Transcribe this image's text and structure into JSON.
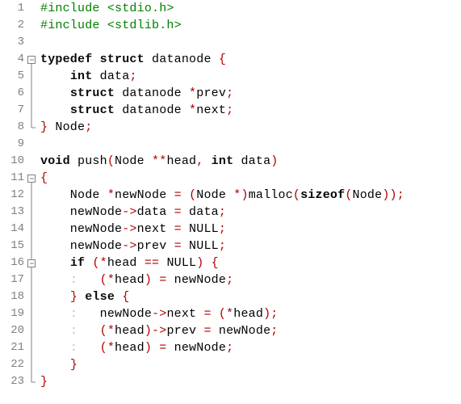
{
  "lines": [
    {
      "n": 1,
      "fold": "none",
      "tokens": [
        [
          "pp",
          "#include <stdio.h>"
        ]
      ]
    },
    {
      "n": 2,
      "fold": "none",
      "tokens": [
        [
          "pp",
          "#include <stdlib.h>"
        ]
      ]
    },
    {
      "n": 3,
      "fold": "none",
      "tokens": []
    },
    {
      "n": 4,
      "fold": "open-top",
      "tokens": [
        [
          "kw",
          "typedef"
        ],
        [
          "id",
          " "
        ],
        [
          "kw",
          "struct"
        ],
        [
          "id",
          " datanode "
        ],
        [
          "op",
          "{"
        ]
      ]
    },
    {
      "n": 5,
      "fold": "mid",
      "tokens": [
        [
          "id",
          "    "
        ],
        [
          "kw",
          "int"
        ],
        [
          "id",
          " data"
        ],
        [
          "op",
          ";"
        ]
      ]
    },
    {
      "n": 6,
      "fold": "mid",
      "tokens": [
        [
          "id",
          "    "
        ],
        [
          "kw",
          "struct"
        ],
        [
          "id",
          " datanode "
        ],
        [
          "op",
          "*"
        ],
        [
          "id",
          "prev"
        ],
        [
          "op",
          ";"
        ]
      ]
    },
    {
      "n": 7,
      "fold": "mid",
      "tokens": [
        [
          "id",
          "    "
        ],
        [
          "kw",
          "struct"
        ],
        [
          "id",
          " datanode "
        ],
        [
          "op",
          "*"
        ],
        [
          "id",
          "next"
        ],
        [
          "op",
          ";"
        ]
      ]
    },
    {
      "n": 8,
      "fold": "end",
      "tokens": [
        [
          "op",
          "}"
        ],
        [
          "id",
          " Node"
        ],
        [
          "op",
          ";"
        ]
      ]
    },
    {
      "n": 9,
      "fold": "none",
      "tokens": []
    },
    {
      "n": 10,
      "fold": "none",
      "tokens": [
        [
          "kw",
          "void"
        ],
        [
          "id",
          " push"
        ],
        [
          "op",
          "("
        ],
        [
          "id",
          "Node "
        ],
        [
          "op",
          "**"
        ],
        [
          "id",
          "head"
        ],
        [
          "op",
          ","
        ],
        [
          "id",
          " "
        ],
        [
          "kw",
          "int"
        ],
        [
          "id",
          " data"
        ],
        [
          "op",
          ")"
        ]
      ]
    },
    {
      "n": 11,
      "fold": "open-top",
      "tokens": [
        [
          "op",
          "{"
        ]
      ]
    },
    {
      "n": 12,
      "fold": "mid",
      "tokens": [
        [
          "id",
          "    Node "
        ],
        [
          "op",
          "*"
        ],
        [
          "id",
          "newNode "
        ],
        [
          "op",
          "="
        ],
        [
          "id",
          " "
        ],
        [
          "op",
          "("
        ],
        [
          "id",
          "Node "
        ],
        [
          "op",
          "*)"
        ],
        [
          "id",
          "malloc"
        ],
        [
          "op",
          "("
        ],
        [
          "fn",
          "sizeof"
        ],
        [
          "op",
          "("
        ],
        [
          "id",
          "Node"
        ],
        [
          "op",
          "));"
        ]
      ]
    },
    {
      "n": 13,
      "fold": "mid",
      "tokens": [
        [
          "id",
          "    newNode"
        ],
        [
          "op",
          "->"
        ],
        [
          "id",
          "data "
        ],
        [
          "op",
          "="
        ],
        [
          "id",
          " data"
        ],
        [
          "op",
          ";"
        ]
      ]
    },
    {
      "n": 14,
      "fold": "mid",
      "tokens": [
        [
          "id",
          "    newNode"
        ],
        [
          "op",
          "->"
        ],
        [
          "id",
          "next "
        ],
        [
          "op",
          "="
        ],
        [
          "id",
          " NULL"
        ],
        [
          "op",
          ";"
        ]
      ]
    },
    {
      "n": 15,
      "fold": "mid",
      "tokens": [
        [
          "id",
          "    newNode"
        ],
        [
          "op",
          "->"
        ],
        [
          "id",
          "prev "
        ],
        [
          "op",
          "="
        ],
        [
          "id",
          " NULL"
        ],
        [
          "op",
          ";"
        ]
      ]
    },
    {
      "n": 16,
      "fold": "open-mid",
      "tokens": [
        [
          "id",
          "    "
        ],
        [
          "kw",
          "if"
        ],
        [
          "id",
          " "
        ],
        [
          "op",
          "(*"
        ],
        [
          "id",
          "head "
        ],
        [
          "op",
          "=="
        ],
        [
          "id",
          " NULL"
        ],
        [
          "op",
          ")"
        ],
        [
          "id",
          " "
        ],
        [
          "op",
          "{"
        ]
      ]
    },
    {
      "n": 17,
      "fold": "mid2",
      "tokens": [
        [
          "id",
          "    "
        ],
        [
          "guide",
          ":"
        ],
        [
          "id",
          "   "
        ],
        [
          "op",
          "(*"
        ],
        [
          "id",
          "head"
        ],
        [
          "op",
          ")"
        ],
        [
          "id",
          " "
        ],
        [
          "op",
          "="
        ],
        [
          "id",
          " newNode"
        ],
        [
          "op",
          ";"
        ]
      ]
    },
    {
      "n": 18,
      "fold": "mid",
      "tokens": [
        [
          "id",
          "    "
        ],
        [
          "op",
          "}"
        ],
        [
          "id",
          " "
        ],
        [
          "kw",
          "else"
        ],
        [
          "id",
          " "
        ],
        [
          "op",
          "{"
        ]
      ]
    },
    {
      "n": 19,
      "fold": "mid2",
      "tokens": [
        [
          "id",
          "    "
        ],
        [
          "guide",
          ":"
        ],
        [
          "id",
          "   newNode"
        ],
        [
          "op",
          "->"
        ],
        [
          "id",
          "next "
        ],
        [
          "op",
          "="
        ],
        [
          "id",
          " "
        ],
        [
          "op",
          "(*"
        ],
        [
          "id",
          "head"
        ],
        [
          "op",
          ");"
        ]
      ]
    },
    {
      "n": 20,
      "fold": "mid2",
      "tokens": [
        [
          "id",
          "    "
        ],
        [
          "guide",
          ":"
        ],
        [
          "id",
          "   "
        ],
        [
          "op",
          "(*"
        ],
        [
          "id",
          "head"
        ],
        [
          "op",
          ")->"
        ],
        [
          "id",
          "prev "
        ],
        [
          "op",
          "="
        ],
        [
          "id",
          " newNode"
        ],
        [
          "op",
          ";"
        ]
      ]
    },
    {
      "n": 21,
      "fold": "mid2",
      "tokens": [
        [
          "id",
          "    "
        ],
        [
          "guide",
          ":"
        ],
        [
          "id",
          "   "
        ],
        [
          "op",
          "(*"
        ],
        [
          "id",
          "head"
        ],
        [
          "op",
          ")"
        ],
        [
          "id",
          " "
        ],
        [
          "op",
          "="
        ],
        [
          "id",
          " newNode"
        ],
        [
          "op",
          ";"
        ]
      ]
    },
    {
      "n": 22,
      "fold": "mid-end",
      "tokens": [
        [
          "id",
          "    "
        ],
        [
          "op",
          "}"
        ]
      ]
    },
    {
      "n": 23,
      "fold": "end",
      "tokens": [
        [
          "op",
          "}"
        ]
      ]
    }
  ],
  "fold_icons": {
    "open-top": "box-minus-top",
    "open-mid": "box-minus-mid",
    "mid": "vline",
    "mid2": "vline",
    "mid-end": "vline",
    "end": "corner",
    "none": ""
  }
}
